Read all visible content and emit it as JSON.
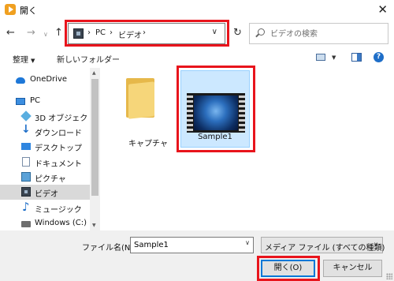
{
  "window": {
    "title": "開く",
    "close_glyph": "✕"
  },
  "nav": {
    "back": "←",
    "forward": "→",
    "recent": "∨",
    "up": "↑",
    "refresh": "↻"
  },
  "address": {
    "segments": [
      "PC",
      "ビデオ"
    ],
    "separator": "›",
    "dropdown": "∨"
  },
  "search": {
    "placeholder": "ビデオの検索"
  },
  "toolbar": {
    "organize": "整理",
    "organize_arrow": "▼",
    "new_folder": "新しいフォルダー",
    "view_arrow": "▼",
    "help": "?"
  },
  "sidebar": {
    "items": [
      {
        "label": "OneDrive",
        "icon": "cloud-icon"
      },
      {
        "label": "PC",
        "icon": "pc-icon"
      },
      {
        "label": "3D オブジェクト",
        "icon": "cube-icon"
      },
      {
        "label": "ダウンロード",
        "icon": "download-icon"
      },
      {
        "label": "デスクトップ",
        "icon": "desktop-icon"
      },
      {
        "label": "ドキュメント",
        "icon": "document-icon"
      },
      {
        "label": "ピクチャ",
        "icon": "picture-icon"
      },
      {
        "label": "ビデオ",
        "icon": "video-icon",
        "selected": true
      },
      {
        "label": "ミュージック",
        "icon": "music-icon"
      },
      {
        "label": "Windows (C:)",
        "icon": "drive-icon"
      }
    ],
    "scroll_up": "▲",
    "scroll_down": "▼"
  },
  "files": [
    {
      "name": "キャプチャ",
      "type": "folder"
    },
    {
      "name": "Sample1",
      "type": "video",
      "selected": true
    }
  ],
  "bottom": {
    "filename_label": "ファイル名(N):",
    "filename_value": "Sample1",
    "filename_dropdown": "∨",
    "filetype": "メディア ファイル (すべての種類)",
    "filetype_dropdown": "∨",
    "open_button": "開く(O)",
    "cancel_button": "キャンセル"
  },
  "colors": {
    "highlight": "#e8141c",
    "accent": "#0078d7",
    "selection": "#cce8ff"
  }
}
